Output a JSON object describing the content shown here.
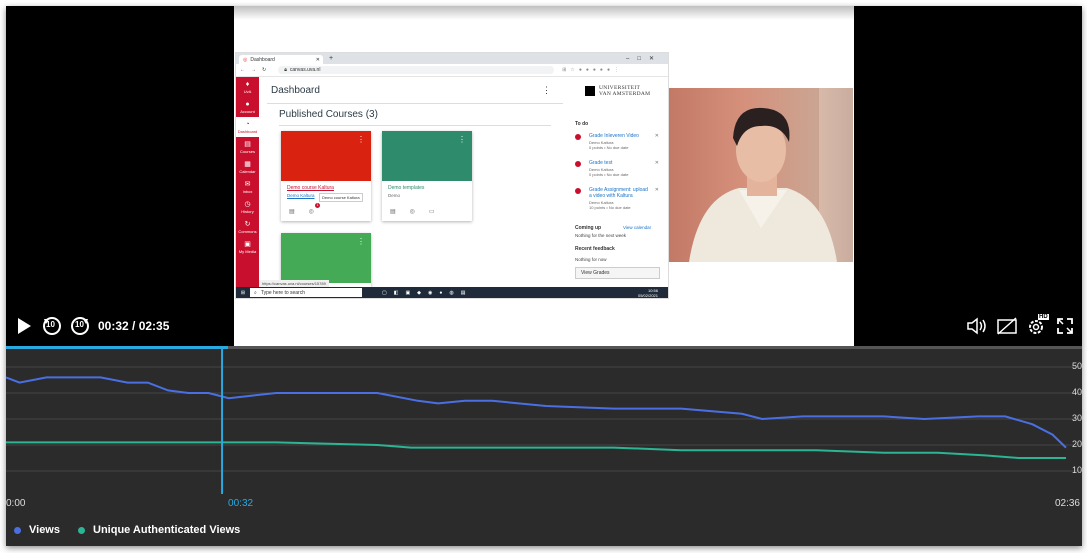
{
  "browser": {
    "tab_title": "Dashboard",
    "url": "canvas.uva.nl",
    "link_status": "https://canvas.uva.nl/courses/15789"
  },
  "global_nav": [
    {
      "label": "UvA",
      "icon": "uva-logo-icon"
    },
    {
      "label": "Account",
      "icon": "account-icon"
    },
    {
      "label": "Dashboard",
      "icon": "dashboard-icon",
      "selected": true
    },
    {
      "label": "Courses",
      "icon": "courses-icon"
    },
    {
      "label": "Calendar",
      "icon": "calendar-icon"
    },
    {
      "label": "Inbox",
      "icon": "inbox-icon"
    },
    {
      "label": "History",
      "icon": "history-icon"
    },
    {
      "label": "Commons",
      "icon": "commons-icon"
    },
    {
      "label": "My Media",
      "icon": "my-media-icon"
    }
  ],
  "dashboard": {
    "title": "Dashboard",
    "section_title": "Published Courses (3)",
    "cards": [
      {
        "title": "Demo course Kaltura",
        "subtitle": "Demo Kaltura",
        "color": "#d9220f",
        "badge": "1",
        "tooltip": "Demo course Kaltura"
      },
      {
        "title": "Demo templates",
        "subtitle": "Demo",
        "color": "#2e8b6b"
      },
      {
        "title": "",
        "subtitle": "",
        "color": "#44aa55"
      }
    ]
  },
  "right_pane": {
    "logo_line1": "UNIVERSITEIT",
    "logo_line2": "VAN AMSTERDAM",
    "todo_heading": "To do",
    "todos": [
      {
        "title": "Grade Inleveren Video",
        "course": "Demo Kaltura",
        "meta": "0 points • No due date"
      },
      {
        "title": "Grade test",
        "course": "Demo Kaltura",
        "meta": "0 points • No due date"
      },
      {
        "title": "Grade Assignment: upload a video with Kaltura",
        "course": "Demo Kaltura",
        "meta": "10 points • No due date"
      }
    ],
    "coming_up_heading": "Coming up",
    "view_calendar": "View calendar",
    "coming_up_text": "Nothing for the next week",
    "feedback_heading": "Recent feedback",
    "feedback_text": "Nothing for now",
    "view_grades": "View Grades"
  },
  "taskbar": {
    "search_placeholder": "Type here to search",
    "time": "10:56",
    "date": "05/02/2021"
  },
  "player": {
    "current_time": "00:32",
    "duration": "02:35",
    "time_display": "00:32 / 02:35",
    "rewind_seconds": "10",
    "forward_seconds": "10",
    "settings_badge": "HD",
    "progress_fraction": 0.2065
  },
  "chart_data": {
    "type": "line",
    "x_unit": "seconds",
    "x_tick_labels": [
      "0:00",
      "00:32",
      "02:36"
    ],
    "ylim": [
      5,
      55
    ],
    "y_tick_labels": [
      "50",
      "40",
      "30",
      "20",
      "10"
    ],
    "grid": true,
    "legend_position": "bottom-left",
    "cursor_x": 32,
    "series": [
      {
        "name": "Views",
        "color": "#4a6fe3",
        "x": [
          0,
          2,
          6,
          9,
          14,
          18,
          21,
          24,
          27,
          30,
          33,
          40,
          55,
          61,
          64,
          68,
          72,
          80,
          90,
          100,
          109,
          112,
          118,
          124,
          130,
          136,
          144,
          148,
          152,
          155,
          157
        ],
        "values": [
          46,
          44,
          46,
          46,
          46,
          44,
          44,
          41,
          40,
          40,
          38,
          40,
          40,
          37,
          36,
          37,
          37,
          35,
          34,
          34,
          32,
          30,
          31,
          31,
          31,
          30,
          31,
          31,
          28,
          24,
          19
        ]
      },
      {
        "name": "Unique Authenticated Views",
        "color": "#2bb594",
        "x": [
          0,
          10,
          20,
          30,
          40,
          55,
          60,
          70,
          80,
          90,
          100,
          110,
          120,
          130,
          138,
          145,
          150,
          157
        ],
        "values": [
          21,
          21,
          21,
          21,
          21,
          20,
          19,
          19,
          19,
          19,
          18,
          18,
          18,
          17,
          17,
          16,
          15,
          15
        ]
      }
    ]
  }
}
